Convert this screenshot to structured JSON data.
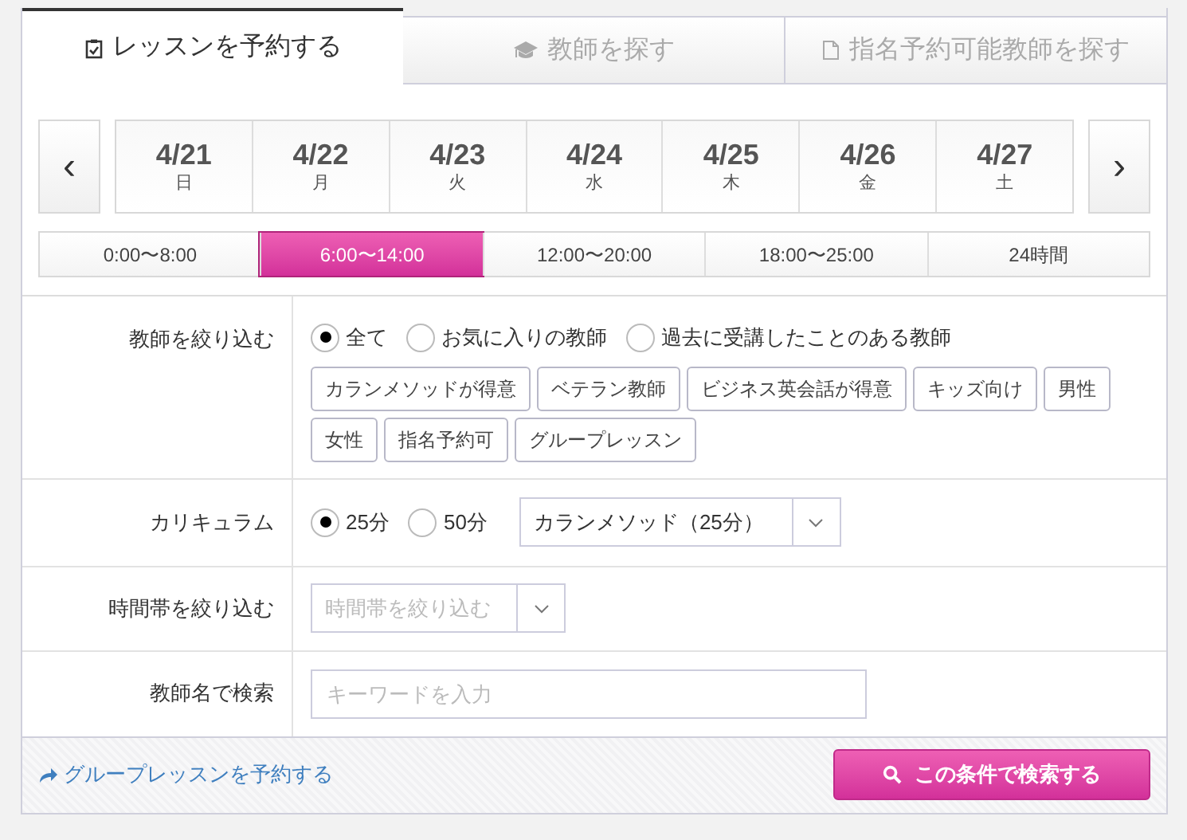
{
  "tabs": [
    {
      "label": "レッスンを予約する",
      "selected": true
    },
    {
      "label": "教師を探す",
      "selected": false
    },
    {
      "label": "指名予約可能教師を探す",
      "selected": false
    }
  ],
  "prev": "‹",
  "next": "›",
  "dates": [
    {
      "date": "4/21",
      "weekday": "日"
    },
    {
      "date": "4/22",
      "weekday": "月"
    },
    {
      "date": "4/23",
      "weekday": "火"
    },
    {
      "date": "4/24",
      "weekday": "水"
    },
    {
      "date": "4/25",
      "weekday": "木"
    },
    {
      "date": "4/26",
      "weekday": "金"
    },
    {
      "date": "4/27",
      "weekday": "土"
    }
  ],
  "time_slots": [
    {
      "label": "0:00〜8:00",
      "selected": false
    },
    {
      "label": "6:00〜14:00",
      "selected": true
    },
    {
      "label": "12:00〜20:00",
      "selected": false
    },
    {
      "label": "18:00〜25:00",
      "selected": false
    },
    {
      "label": "24時間",
      "selected": false
    }
  ],
  "filters": [
    {
      "kind": "teacher",
      "label": "教師を絞り込む",
      "options": [
        {
          "label": "全て",
          "selected": true
        },
        {
          "label": "お気に入りの教師",
          "selected": false
        },
        {
          "label": "過去に受講したことのある教師",
          "selected": false
        }
      ],
      "tags": [
        "カランメソッドが得意",
        "ベテラン教師",
        "ビジネス英会話が得意",
        "キッズ向け",
        "男性",
        "女性",
        "指名予約可",
        "グループレッスン"
      ]
    },
    {
      "kind": "curriculum",
      "label": "カリキュラム",
      "options": [
        {
          "label": "25分",
          "selected": true
        },
        {
          "label": "50分",
          "selected": false
        }
      ],
      "select": {
        "value": "カランメソッド（25分）"
      }
    },
    {
      "kind": "timeband",
      "label": "時間帯を絞り込む",
      "select": {
        "placeholder": "時間帯を絞り込む"
      }
    },
    {
      "kind": "name",
      "label": "教師名で検索",
      "input": {
        "placeholder": "キーワードを入力"
      }
    }
  ],
  "footer": {
    "link": "グループレッスンを予約する",
    "button": "この条件で検索する"
  }
}
